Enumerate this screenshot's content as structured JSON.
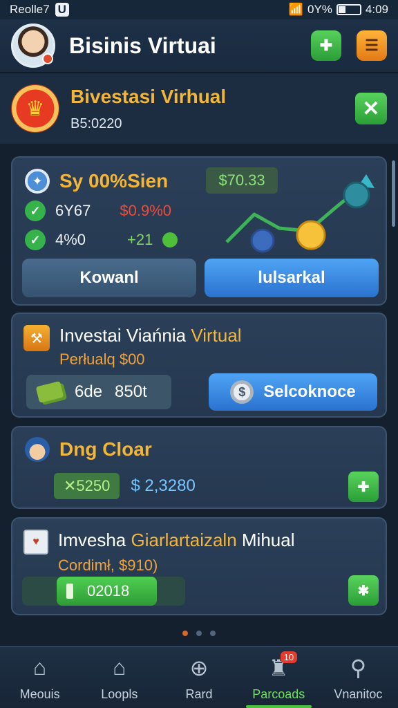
{
  "status": {
    "carrier": "Reolle7",
    "notif_icon": "U",
    "battery_text": "0Y%",
    "time": "4:09"
  },
  "header": {
    "title": "Bisinis Virtuai"
  },
  "banner": {
    "title": "Bivestasi Virhual",
    "subtitle": "B5:0220"
  },
  "card1": {
    "title": "Sy 00%Sien",
    "price": "$70.33",
    "row1_left": "6Y67",
    "row1_right": "$0.9%0",
    "row2_left": "4%0",
    "row2_right": "+21",
    "btn_left": "Kowanl",
    "btn_right": "lulsarkal"
  },
  "card2": {
    "title_part1": "Investai Viańnia ",
    "title_part2": "Virtual",
    "subtitle": "Perłualq $00",
    "money_label": "6de",
    "money_value": "850t",
    "action_label": "Selcoknoce",
    "coin_symbol": "$"
  },
  "card3": {
    "title": "Dng Cloar",
    "chip_value": "✕5250",
    "amount": "$ 2,3280"
  },
  "card4": {
    "title_part1": "Imvesha ",
    "title_part2": "Giarlartaizaln",
    "title_part3": " Mihual",
    "subtitle": "Cordimł, $910)",
    "progress_value": "02018",
    "progress_fraction": 0.78
  },
  "nav": [
    {
      "label": "Meouis"
    },
    {
      "label": "Loopls"
    },
    {
      "label": "Rard"
    },
    {
      "label": "Parcoads",
      "badge": "10"
    },
    {
      "label": "Vnanitoc"
    }
  ],
  "colors": {
    "accent_gold": "#f4b638",
    "action_blue": "#2a72cf",
    "success_green": "#36b24a",
    "background": "#1b2a3c"
  }
}
